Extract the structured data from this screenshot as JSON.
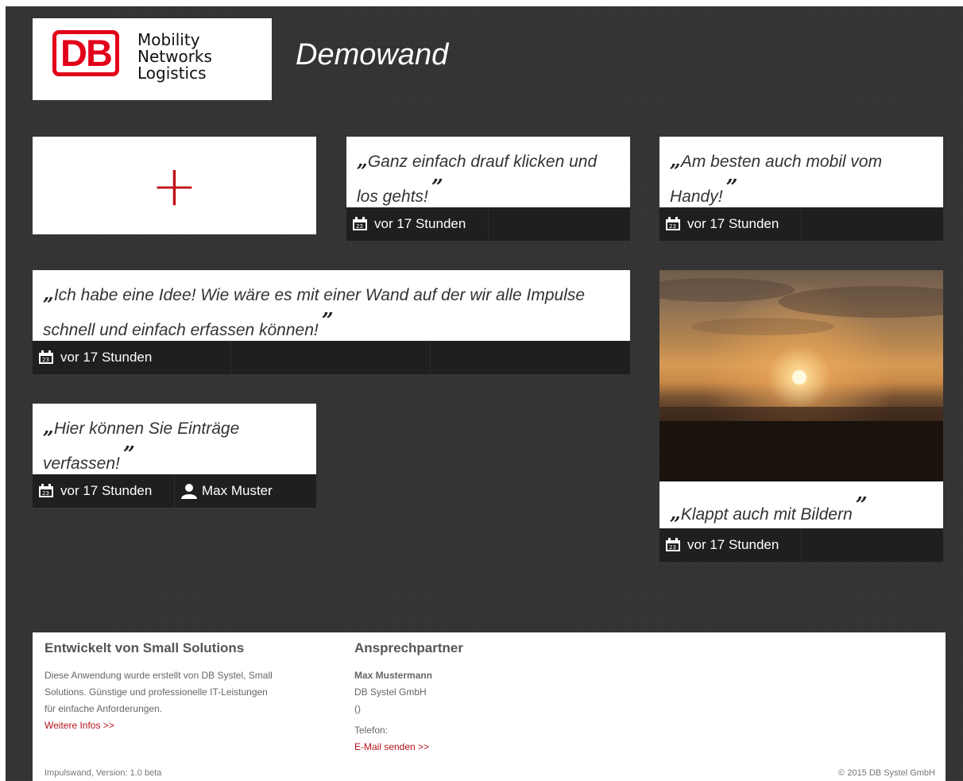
{
  "header": {
    "brand": {
      "mark": "DB",
      "line1": "Mobility",
      "line2": "Networks",
      "line3": "Logistics"
    },
    "title": "Demowand"
  },
  "add_card": {
    "symbol": "+"
  },
  "posts": [
    {
      "text": "Ganz einfach drauf klicken und los gehts!",
      "time": "vor 17 Stunden"
    },
    {
      "text": "Am besten auch mobil vom Handy!",
      "time": "vor 17 Stunden"
    },
    {
      "text": "Ich habe eine Idee! Wie wäre es mit einer Wand auf der wir alle Impulse schnell und einfach erfassen können!",
      "time": "vor 17 Stunden"
    },
    {
      "text": "Hier können Sie Einträge verfassen!",
      "time": "vor 17 Stunden",
      "author": "Max Muster"
    },
    {
      "text": "Klappt auch mit Bildern",
      "time": "vor 17 Stunden",
      "image": "sunset"
    }
  ],
  "quote_marks": {
    "open": "„",
    "close": "”"
  },
  "icons": {
    "time": "calendar-icon",
    "author": "user-icon"
  },
  "colors": {
    "accent": "#c0121a",
    "background": "#333333",
    "meta_bar": "#1f1f1f"
  },
  "footer": {
    "about": {
      "heading": "Entwickelt von Small Solutions",
      "line1": "Diese Anwendung wurde erstellt von DB Systel, Small",
      "line2": "Solutions. Günstige und professionelle IT-Leistungen",
      "line3": "für einfache Anforderungen.",
      "link": "Weitere Infos >>"
    },
    "contact": {
      "heading": "Ansprechpartner",
      "name": "Max Mustermann",
      "company": "DB Systel GmbH",
      "location": "()",
      "phone_label": "Telefon:",
      "email_link": "E-Mail senden >>"
    },
    "version": "Impulswand, Version: 1.0 beta",
    "copyright": "© 2015 DB Systel GmbH"
  }
}
